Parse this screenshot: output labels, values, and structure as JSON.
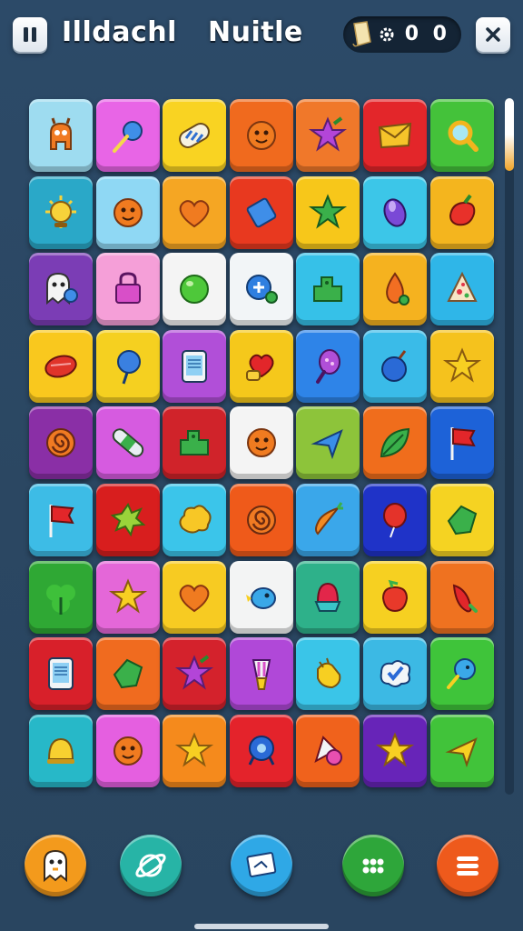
{
  "header": {
    "title_left": "Illdachl",
    "title_right": "Nuitle",
    "score": "0 0",
    "pause_icon": "pause-icon",
    "close_icon": "close-icon",
    "scroll_icon": "scroll-icon",
    "gear_icon": "gear-icon"
  },
  "board": {
    "rows": 9,
    "cols": 7,
    "tiles": [
      [
        {
          "c": "#9edcf0",
          "i": "creature"
        },
        {
          "c": "#e865e6",
          "i": "orb-wand"
        },
        {
          "c": "#f9d322",
          "i": "capsule"
        },
        {
          "c": "#f06a1e",
          "i": "face"
        },
        {
          "c": "#f0782a",
          "i": "star-purple"
        },
        {
          "c": "#e3262a",
          "i": "envelope"
        },
        {
          "c": "#44c23a",
          "i": "magnifier"
        }
      ],
      [
        {
          "c": "#2aa8c8",
          "i": "sun"
        },
        {
          "c": "#8fd8f4",
          "i": "face"
        },
        {
          "c": "#f5a623",
          "i": "heart"
        },
        {
          "c": "#e8391f",
          "i": "diamond"
        },
        {
          "c": "#f7c71a",
          "i": "star-green"
        },
        {
          "c": "#3cc6e8",
          "i": "bean"
        },
        {
          "c": "#f4b51e",
          "i": "pepper"
        }
      ],
      [
        {
          "c": "#7b3db5",
          "i": "ghost"
        },
        {
          "c": "#f59fd8",
          "i": "lock"
        },
        {
          "c": "#f4f4f4",
          "i": "ball-green"
        },
        {
          "c": "#f2f5f7",
          "i": "orb-plus"
        },
        {
          "c": "#36c1e8",
          "i": "blocks"
        },
        {
          "c": "#f5b21f",
          "i": "drop"
        },
        {
          "c": "#2fb6e8",
          "i": "cheese"
        }
      ],
      [
        {
          "c": "#f9c81e",
          "i": "ball-red"
        },
        {
          "c": "#f5d020",
          "i": "candy"
        },
        {
          "c": "#b14fd8",
          "i": "tablet"
        },
        {
          "c": "#f5c81b",
          "i": "heart-hand"
        },
        {
          "c": "#2e84e8",
          "i": "racket"
        },
        {
          "c": "#3abbe8",
          "i": "plum"
        },
        {
          "c": "#f5c21d",
          "i": "star"
        }
      ],
      [
        {
          "c": "#8a2fa6",
          "i": "swirl"
        },
        {
          "c": "#d65be0",
          "i": "bandage"
        },
        {
          "c": "#d0232a",
          "i": "blocks"
        },
        {
          "c": "#f4f4f4",
          "i": "face"
        },
        {
          "c": "#8dc43a",
          "i": "arrow"
        },
        {
          "c": "#f06d1c",
          "i": "leaf"
        },
        {
          "c": "#1d62d8",
          "i": "flag"
        }
      ],
      [
        {
          "c": "#3dbce6",
          "i": "flag"
        },
        {
          "c": "#d81e1e",
          "i": "splat"
        },
        {
          "c": "#3bc5ea",
          "i": "cloud"
        },
        {
          "c": "#ef5a1a",
          "i": "swirl"
        },
        {
          "c": "#3aa7ea",
          "i": "carrot"
        },
        {
          "c": "#1f33c8",
          "i": "balloon"
        },
        {
          "c": "#f5d322",
          "i": "shield"
        }
      ],
      [
        {
          "c": "#2fa834",
          "i": "clover"
        },
        {
          "c": "#e467d8",
          "i": "star"
        },
        {
          "c": "#f7cb22",
          "i": "heart"
        },
        {
          "c": "#f3f4f4",
          "i": "bird"
        },
        {
          "c": "#2eb18a",
          "i": "gem"
        },
        {
          "c": "#f6d021",
          "i": "berry"
        },
        {
          "c": "#ef7220",
          "i": "chili"
        }
      ],
      [
        {
          "c": "#d8202a",
          "i": "tablet"
        },
        {
          "c": "#f06b1f",
          "i": "shield"
        },
        {
          "c": "#d4222c",
          "i": "star-purple"
        },
        {
          "c": "#b048d8",
          "i": "brush"
        },
        {
          "c": "#3ac5e8",
          "i": "hand"
        },
        {
          "c": "#3cb9e4",
          "i": "badge"
        },
        {
          "c": "#3fc43a",
          "i": "fish"
        }
      ],
      [
        {
          "c": "#27b8c8",
          "i": "bell"
        },
        {
          "c": "#e55fe0",
          "i": "face"
        },
        {
          "c": "#f58a1c",
          "i": "star"
        },
        {
          "c": "#e4232b",
          "i": "orb-blue"
        },
        {
          "c": "#f0621c",
          "i": "mask"
        },
        {
          "c": "#6724b8",
          "i": "star"
        },
        {
          "c": "#41c33a",
          "i": "arrow-yellow"
        }
      ]
    ]
  },
  "controls": [
    {
      "name": "ghost-button",
      "icon": "ghost-icon",
      "color": "#f39a1c"
    },
    {
      "name": "shuffle-button",
      "icon": "planet-icon",
      "color": "#27b4a6"
    },
    {
      "name": "hint-button",
      "icon": "card-icon",
      "color": "#2fa8e6"
    },
    {
      "name": "dots-button",
      "icon": "dots-icon",
      "color": "#2ea63a"
    },
    {
      "name": "menu-button",
      "icon": "menu-icon",
      "color": "#ee5a1c"
    }
  ],
  "scroll": {
    "position": 0.0,
    "visible_fraction": 0.75
  }
}
